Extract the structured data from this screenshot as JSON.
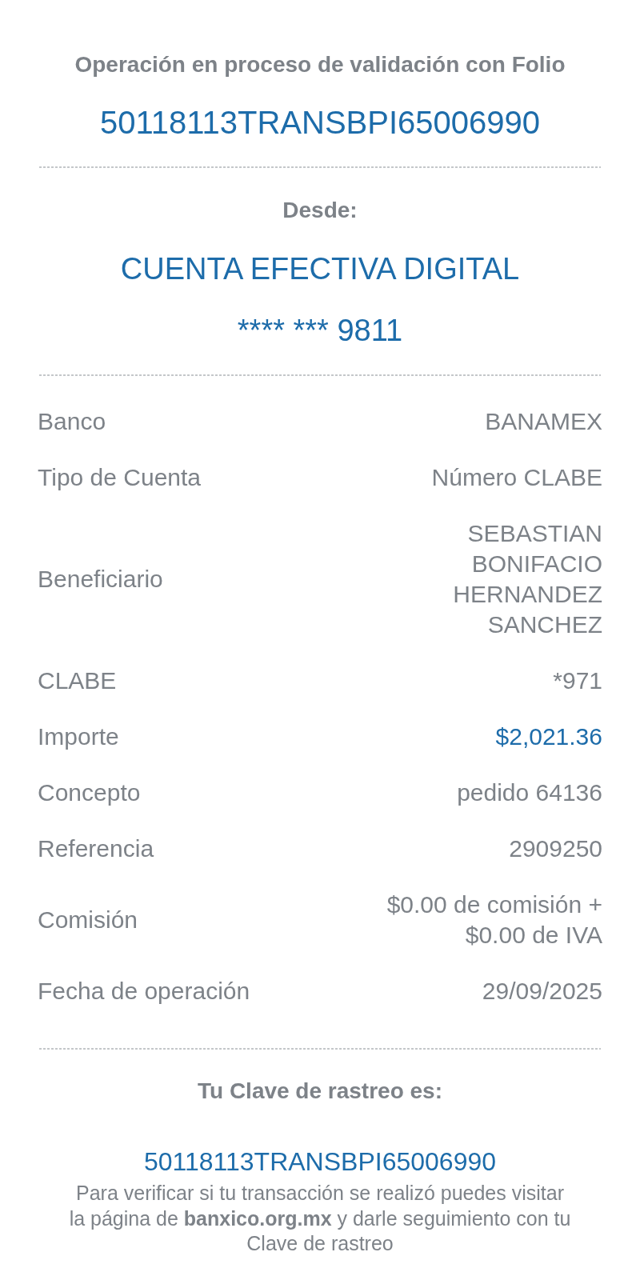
{
  "header": {
    "title": "Operación en proceso de validación con Folio",
    "folio": "50118113TRANSBPI65006990"
  },
  "origin": {
    "label": "Desde:",
    "account_name": "CUENTA EFECTIVA DIGITAL",
    "account_number": "**** *** 9811"
  },
  "details": [
    {
      "label": "Banco",
      "value": "BANAMEX",
      "kind": "text"
    },
    {
      "label": "Tipo de Cuenta",
      "value": "Número CLABE",
      "kind": "text"
    },
    {
      "label": "Beneficiario",
      "value": "SEBASTIAN BONIFACIO HERNANDEZ SANCHEZ",
      "kind": "text"
    },
    {
      "label": "CLABE",
      "value": "*971",
      "kind": "text"
    },
    {
      "label": "Importe",
      "value": "$2,021.36",
      "kind": "amount"
    },
    {
      "label": "Concepto",
      "value": "pedido 64136",
      "kind": "text"
    },
    {
      "label": "Referencia",
      "value": "2909250",
      "kind": "text"
    },
    {
      "label": "Comisión",
      "value": "$0.00 de comisión + $0.00 de IVA",
      "kind": "text"
    },
    {
      "label": "Fecha de operación",
      "value": "29/09/2025",
      "kind": "text"
    }
  ],
  "tracking": {
    "label": "Tu Clave de rastreo es:",
    "key": "50118113TRANSBPI65006990",
    "note": "Para verificar si tu transacción se realizó puedes visitar la página de **banxico.org.mx** y darle seguimiento con tu Clave de rastreo"
  }
}
